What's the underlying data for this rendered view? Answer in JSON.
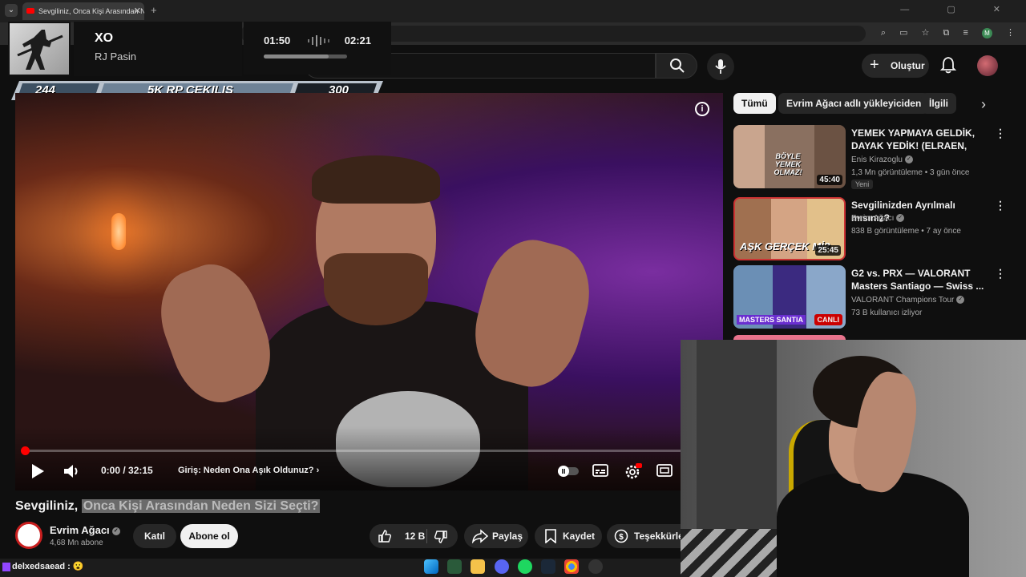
{
  "browser": {
    "tab_title": "Sevgiliniz, Onca Kişi Arasından N",
    "tab_close": "✕",
    "new_tab": "+",
    "window_controls": "—  ▢  ✕",
    "profile_letter": "M"
  },
  "music_widget": {
    "song": "XO",
    "artist": "RJ Pasin",
    "elapsed": "01:50",
    "total": "02:21",
    "progress": 0.78
  },
  "rp_banner": {
    "left_number": "244",
    "title": "5K RP CEKILIS",
    "right_number": "300"
  },
  "header": {
    "create_label": "Oluştur",
    "create_plus": "+"
  },
  "player": {
    "time": "0:00 / 32:15",
    "chapter": "Giriş: Neden Ona Aşık Oldunuz?",
    "chapter_arrow": "›",
    "info_icon": "i",
    "progress": 0.0
  },
  "video": {
    "title_plain": "Sevgiliniz,",
    "title_selected": "Onca Kişi Arasından Neden Sizi Seçti?",
    "channel": "Evrim Ağacı",
    "subscribers": "4,68 Mn abone",
    "join_label": "Katıl",
    "subscribe_label": "Abone ol",
    "likes": "12 B",
    "share_label": "Paylaş",
    "save_label": "Kaydet",
    "thanks_label": "Teşekkürle"
  },
  "sidebar": {
    "chips": [
      "Tümü",
      "Evrim Ağacı adlı yükleyiciden",
      "İlgili"
    ],
    "chevron": "›",
    "recommendations": [
      {
        "title": "YEMEK YAPMAYA GELDİK, DAYAK YEDİK! (ELRAEN, ERAY,...",
        "channel": "Enis Kirazoglu",
        "meta": "1,3 Mn görüntüleme • 3 gün önce",
        "duration": "45:40",
        "badge": "Yeni",
        "thumb_text": "BÖYLE YEMEK OLMAZ!"
      },
      {
        "title": "Sevgilinizden Ayrılmalı mısınız?",
        "channel": "Evrim Ağacı",
        "meta": "838 B görüntüleme • 7 ay önce",
        "duration": "25:45",
        "thumb_text": "AŞK GERÇEK Mİ?"
      },
      {
        "title": "G2 vs. PRX — VALORANT Masters Santiago — Swiss ...",
        "channel": "VALORANT Champions Tour",
        "meta": "73 B kullanıcı izliyor",
        "live": "CANLI",
        "thumb_text": "MASTERS SANTIA"
      }
    ]
  },
  "taskbar": {
    "chat_user": "delxedsaead :",
    "chat_emoji": "😮"
  },
  "colors": {
    "accent_red": "#ff0000",
    "bg": "#0f0f0f",
    "chip_bg": "#272727"
  },
  "icons": [
    "search-icon",
    "mic-icon",
    "bell-icon",
    "play-icon",
    "volume-icon",
    "captions-icon",
    "settings-icon",
    "theater-icon",
    "like-icon",
    "dislike-icon",
    "share-icon",
    "save-icon",
    "thanks-icon",
    "kebab-icon",
    "verified-icon"
  ]
}
